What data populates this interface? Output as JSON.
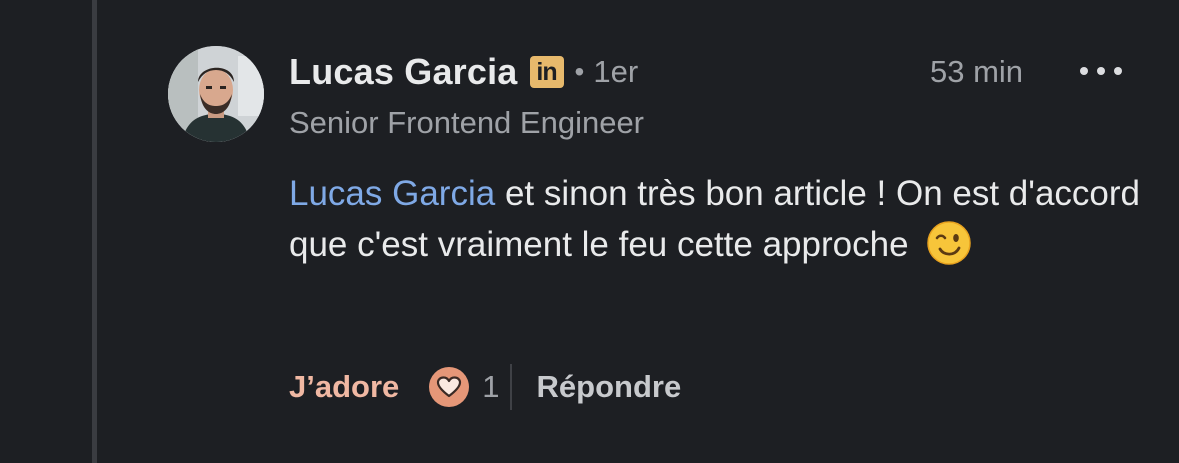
{
  "comment": {
    "author": {
      "name": "Lucas Garcia",
      "badge": "in",
      "separator": "•",
      "degree": "1er",
      "headline": "Senior Frontend Engineer"
    },
    "time": "53 min",
    "body": {
      "mention": "Lucas Garcia",
      "text": " et sinon très bon article ! On est d'accord que c'est vraiment le feu cette approche"
    },
    "actions": {
      "like_label": "J’adore",
      "reaction_count": "1",
      "reply_label": "Répondre"
    }
  },
  "icons": {
    "more": "more-horizontal-icon",
    "reaction": "heart-icon",
    "emoji": "winking-face-emoji"
  },
  "colors": {
    "background": "#1d1f23",
    "mention": "#7fa9e6",
    "like": "#f0b8a3",
    "linkedin_badge": "#e7b96c"
  }
}
